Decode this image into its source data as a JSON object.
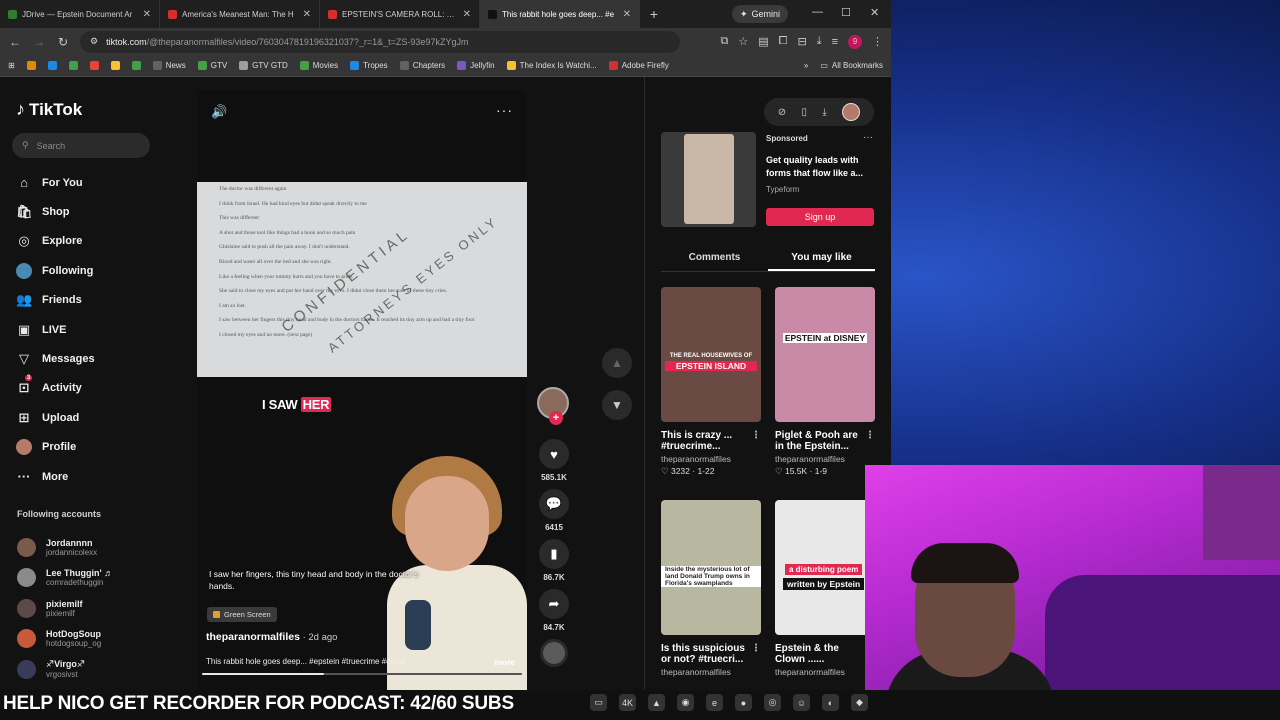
{
  "browser": {
    "tabs": [
      {
        "label": "JDrive — Epstein Document Ar",
        "color": "#2e7d32",
        "active": false
      },
      {
        "label": "America's Meanest Man: The H",
        "color": "#d32f2f",
        "active": false
      },
      {
        "label": "EPSTEIN'S CAMERA ROLL: The I",
        "color": "#d32f2f",
        "active": false
      },
      {
        "label": "This rabbit hole goes deep... #e",
        "color": "#111111",
        "active": true
      }
    ],
    "new_tab": "+",
    "gemini": "Gemini",
    "url_host": "tiktok.com",
    "url_path": "/@theparanormalfiles/video/7603047819196321037?_r=1&_t=ZS-93e97kZYgJm",
    "profile_initial": "9",
    "bookmarks": [
      {
        "label": "News",
        "color": "#5f6368"
      },
      {
        "label": "GTV",
        "color": "#43a047"
      },
      {
        "label": "GTV GTD",
        "color": "#9e9e9e"
      },
      {
        "label": "Movies",
        "color": "#43a047"
      },
      {
        "label": "Tropes",
        "color": "#1e88e5"
      },
      {
        "label": "Chapters",
        "color": "#5f6368"
      },
      {
        "label": "Jellyfin",
        "color": "#7e57c2"
      },
      {
        "label": "The Index Is Watchi...",
        "color": "#fbc02d"
      },
      {
        "label": "Adobe Firefly",
        "color": "#d32f2f"
      }
    ],
    "all_bookmarks": "All Bookmarks"
  },
  "tiktok": {
    "logo": "TikTok",
    "search_placeholder": "Search",
    "nav": [
      {
        "label": "For You",
        "icon": "home-icon",
        "glyph": "⌂"
      },
      {
        "label": "Shop",
        "icon": "shop-icon",
        "glyph": "🛍"
      },
      {
        "label": "Explore",
        "icon": "compass-icon",
        "glyph": "◎"
      },
      {
        "label": "Following",
        "icon": "following-avatar",
        "glyph": ""
      },
      {
        "label": "Friends",
        "icon": "friends-icon",
        "glyph": "👥"
      },
      {
        "label": "LIVE",
        "icon": "live-icon",
        "glyph": "▣"
      },
      {
        "label": "Messages",
        "icon": "messages-icon",
        "glyph": "▽"
      },
      {
        "label": "Activity",
        "icon": "activity-icon",
        "glyph": "⊡"
      },
      {
        "label": "Upload",
        "icon": "upload-icon",
        "glyph": "⊞"
      },
      {
        "label": "Profile",
        "icon": "profile-avatar",
        "glyph": ""
      },
      {
        "label": "More",
        "icon": "more-icon",
        "glyph": "···"
      }
    ],
    "activity_badge": "3",
    "following_title": "Following accounts",
    "following": [
      {
        "name": "Jordannnn",
        "handle": "jordannicolexx",
        "color": "#7a5a4a"
      },
      {
        "name": "Lee Thuggin' ♬",
        "handle": "comradethuggin",
        "color": "#8a8a8a"
      },
      {
        "name": "pixiemilf",
        "handle": "pixiemilf",
        "color": "#5a4a4a"
      },
      {
        "name": "HotDogSoup",
        "handle": "hotdogsoup_og",
        "color": "#c85a3a"
      },
      {
        "name": "♐Virgo♐",
        "handle": "vrgosivst",
        "color": "#3a3a5a"
      }
    ]
  },
  "video": {
    "doc_lines": [
      "The doctor was different again",
      "I think from Israel.     He had kind eyes but didnt speak directly to me",
      "This was different",
      "A shot and those tool like things had a hook and so much pain",
      "Ghislaine said to push all the pain away. I don't understand.",
      "Blood and water all over the bed and she was right.",
      "Like a feeling when your tummy hurts and you have to push.",
      "She said to close my eyes and put her hand over my eyes. I didnt close them because of these tiny cries.",
      "I am so lost.",
      "I saw between her fingers this tiny head and body in the doctors hands. It reached its tiny arm up and had a tiny foot",
      "I closed my eyes and no more.      (next page)"
    ],
    "watermark_1": "CONFIDENTIAL",
    "watermark_2": "ATTORNEYS EYES ONLY",
    "overlay_text_1": "I SAW",
    "overlay_text_2": "HER",
    "caption": "I saw her fingers, this tiny head and body in the doctor's hands.",
    "sticker": "Green Screen",
    "author": "theparanormalfiles",
    "posted": " · 2d ago",
    "description": "This rabbit hole goes deep... #epstein #truecrime #crime ...",
    "more": "more",
    "progress_fraction": 0.38
  },
  "actions": {
    "likes": "585.1K",
    "comments": "6415",
    "saves": "86.7K",
    "shares": "84.7K"
  },
  "rightpanel": {
    "ad": {
      "sponsored": "Sponsored",
      "headline": "Get quality leads with forms that flow like a...",
      "brand": "Typeform",
      "cta": "Sign up"
    },
    "tabs": [
      "Comments",
      "You may like"
    ],
    "selected_tab": 1,
    "cards": [
      {
        "title": "This is crazy ...",
        "title2": "#truecrime...",
        "author": "theparanormalfiles",
        "stats": "♡ 3232 · 1-22",
        "overlay_top": "THE REAL HOUSEWIVES OF",
        "overlay_main": "EPSTEIN ISLAND",
        "bg": "#6a4a42"
      },
      {
        "title": "Piglet & Pooh are",
        "title2": "in the Epstein...",
        "author": "theparanormalfiles",
        "stats": "♡ 15.5K · 1-9",
        "overlay_top": "",
        "overlay_main": "EPSTEIN at DISNEY",
        "bg": "#c88aa6"
      },
      {
        "title": "Is this suspicious",
        "title2": "or not? #truecri...",
        "author": "theparanormalfiles",
        "stats": "",
        "overlay_top": "Inside the mysterious lot of land Donald Trump owns in Florida's swamplands",
        "overlay_main": "",
        "bg": "#b8b8a0"
      },
      {
        "title": "Epstein & the",
        "title2": "Clown ......",
        "author": "theparanormalfiles",
        "stats": "",
        "overlay_top": "a disturbing poem",
        "overlay_main": "written by Epstein",
        "bg": "#e8e8e8"
      }
    ]
  },
  "banner": "HELP NICO GET RECORDER FOR PODCAST: 42/60 SUBS"
}
